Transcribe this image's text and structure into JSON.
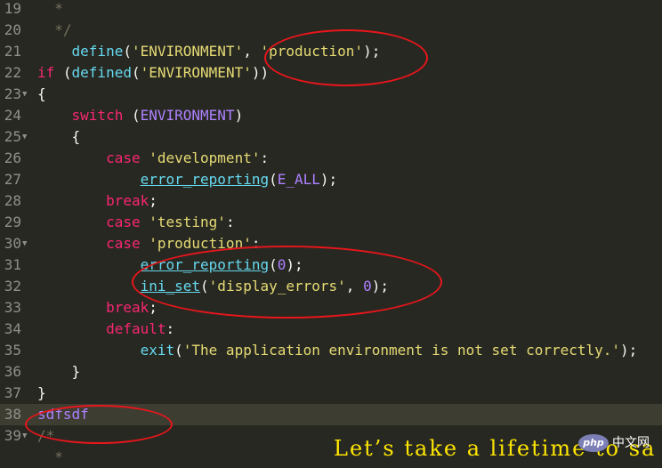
{
  "editor": {
    "lines": [
      {
        "n": "19",
        "fold": "",
        "tokens": [
          [
            "c",
            "  *"
          ]
        ]
      },
      {
        "n": "20",
        "fold": "",
        "tokens": [
          [
            "c",
            "  */"
          ]
        ]
      },
      {
        "n": "21",
        "fold": "",
        "tokens": [
          [
            "p",
            "    "
          ],
          [
            "f",
            "define"
          ],
          [
            "p",
            "("
          ],
          [
            "s",
            "'ENVIRONMENT'"
          ],
          [
            "p",
            ", "
          ],
          [
            "s",
            "'production'"
          ],
          [
            "p",
            ");"
          ]
        ]
      },
      {
        "n": "22",
        "fold": "",
        "tokens": [
          [
            "k",
            "if"
          ],
          [
            "p",
            " ("
          ],
          [
            "f",
            "defined"
          ],
          [
            "p",
            "("
          ],
          [
            "s",
            "'ENVIRONMENT'"
          ],
          [
            "p",
            "))"
          ]
        ]
      },
      {
        "n": "23",
        "fold": "▼",
        "tokens": [
          [
            "p",
            "{"
          ]
        ]
      },
      {
        "n": "24",
        "fold": "",
        "tokens": [
          [
            "p",
            "    "
          ],
          [
            "k",
            "switch"
          ],
          [
            "p",
            " ("
          ],
          [
            "v",
            "ENVIRONMENT"
          ],
          [
            "p",
            ")"
          ]
        ]
      },
      {
        "n": "25",
        "fold": "▼",
        "tokens": [
          [
            "p",
            "    {"
          ]
        ]
      },
      {
        "n": "26",
        "fold": "",
        "tokens": [
          [
            "p",
            "        "
          ],
          [
            "k",
            "case"
          ],
          [
            "p",
            " "
          ],
          [
            "s",
            "'development'"
          ],
          [
            "p",
            ":"
          ]
        ]
      },
      {
        "n": "27",
        "fold": "",
        "tokens": [
          [
            "p",
            "            "
          ],
          [
            "fn",
            "error_reporting"
          ],
          [
            "p",
            "("
          ],
          [
            "v",
            "E_ALL"
          ],
          [
            "p",
            ");"
          ]
        ]
      },
      {
        "n": "28",
        "fold": "",
        "tokens": [
          [
            "p",
            "        "
          ],
          [
            "k",
            "break"
          ],
          [
            "p",
            ";"
          ]
        ]
      },
      {
        "n": "29",
        "fold": "",
        "tokens": [
          [
            "p",
            "        "
          ],
          [
            "k",
            "case"
          ],
          [
            "p",
            " "
          ],
          [
            "s",
            "'testing'"
          ],
          [
            "p",
            ":"
          ]
        ]
      },
      {
        "n": "30",
        "fold": "▼",
        "tokens": [
          [
            "p",
            "        "
          ],
          [
            "k",
            "case"
          ],
          [
            "p",
            " "
          ],
          [
            "s",
            "'production'"
          ],
          [
            "p",
            ":"
          ]
        ]
      },
      {
        "n": "31",
        "fold": "",
        "tokens": [
          [
            "p",
            "            "
          ],
          [
            "fn",
            "error_reporting"
          ],
          [
            "p",
            "("
          ],
          [
            "n",
            "0"
          ],
          [
            "p",
            ");"
          ]
        ]
      },
      {
        "n": "32",
        "fold": "",
        "tokens": [
          [
            "p",
            "            "
          ],
          [
            "fn",
            "ini_set"
          ],
          [
            "p",
            "("
          ],
          [
            "s",
            "'display_errors'"
          ],
          [
            "p",
            ", "
          ],
          [
            "n",
            "0"
          ],
          [
            "p",
            ");"
          ]
        ]
      },
      {
        "n": "33",
        "fold": "",
        "tokens": [
          [
            "p",
            "        "
          ],
          [
            "k",
            "break"
          ],
          [
            "p",
            ";"
          ]
        ]
      },
      {
        "n": "34",
        "fold": "",
        "tokens": [
          [
            "p",
            "        "
          ],
          [
            "k",
            "default"
          ],
          [
            "p",
            ":"
          ]
        ]
      },
      {
        "n": "35",
        "fold": "",
        "tokens": [
          [
            "p",
            "            "
          ],
          [
            "f",
            "exit"
          ],
          [
            "p",
            "("
          ],
          [
            "s",
            "'The application environment is not set correctly.'"
          ],
          [
            "p",
            ");"
          ]
        ]
      },
      {
        "n": "36",
        "fold": "",
        "tokens": [
          [
            "p",
            "    }"
          ]
        ]
      },
      {
        "n": "37",
        "fold": "",
        "tokens": [
          [
            "p",
            "}"
          ]
        ]
      },
      {
        "n": "38",
        "fold": "",
        "tokens": [
          [
            "v",
            "sdfsdf"
          ]
        ],
        "active": true
      },
      {
        "n": "39",
        "fold": "▼",
        "tokens": [
          [
            "c",
            "/*"
          ]
        ]
      },
      {
        "n": "",
        "fold": "",
        "tokens": [
          [
            "c",
            "  *"
          ]
        ]
      }
    ]
  },
  "watermark": "Let’s take a lifetime to sa",
  "logo": {
    "badge": "php",
    "text": "中文网"
  },
  "colors": {
    "annotation_ring": "#e8161b",
    "background": "#272822"
  }
}
